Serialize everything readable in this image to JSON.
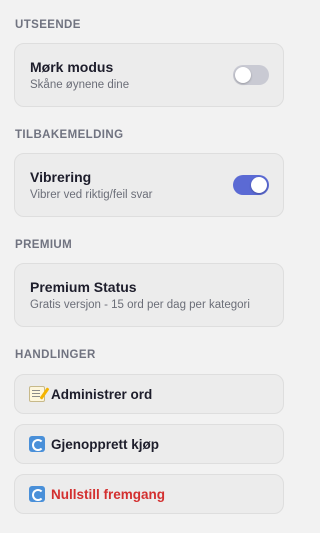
{
  "sections": {
    "appearance": {
      "header": "UTSEENDE",
      "title": "Mørk modus",
      "subtitle": "Skåne øynene dine",
      "toggle_on": false
    },
    "feedback": {
      "header": "TILBAKEMELDING",
      "title": "Vibrering",
      "subtitle": "Vibrer ved riktig/feil svar",
      "toggle_on": true
    },
    "premium": {
      "header": "PREMIUM",
      "title": "Premium Status",
      "subtitle": "Gratis versjon - 15 ord per dag per kategori"
    },
    "actions": {
      "header": "HANDLINGER",
      "items": [
        {
          "label": "Administrer ord",
          "icon": "memo-icon"
        },
        {
          "label": "Gjenopprett kjøp",
          "icon": "repeat-icon"
        },
        {
          "label": "Nullstill fremgang",
          "icon": "repeat-icon",
          "danger": true
        }
      ]
    }
  },
  "colors": {
    "background": "#f2f2f2",
    "card": "#ececec",
    "accent": "#5b6ad4",
    "toggle_off": "#c9cad3",
    "danger": "#d32f2f",
    "section_header": "#707380"
  }
}
